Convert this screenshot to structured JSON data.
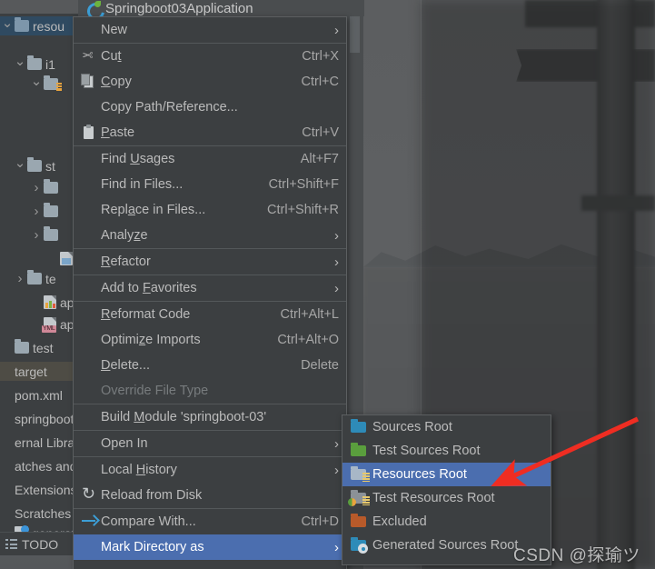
{
  "window": {
    "editor_tab": {
      "title": "Springboot03Application",
      "icon": "spring-boot-icon"
    }
  },
  "sidebar": {
    "tree": [
      {
        "label": "resou",
        "indent": 0,
        "chevron": "down",
        "icon": "folder-blue-icon",
        "selected": true
      },
      {
        "label": "i1",
        "indent": 1,
        "chevron": "down",
        "icon": "folder-icon",
        "selected": false
      },
      {
        "label": "",
        "indent": 2,
        "chevron": "down",
        "icon": "folder-resources-icon",
        "selected": false
      },
      {
        "label": "st",
        "indent": 1,
        "chevron": "down",
        "icon": "folder-icon",
        "selected": false
      },
      {
        "label": "",
        "indent": 2,
        "chevron": "right",
        "icon": "folder-icon",
        "selected": false
      },
      {
        "label": "",
        "indent": 2,
        "chevron": "right",
        "icon": "folder-icon",
        "selected": false
      },
      {
        "label": "",
        "indent": 2,
        "chevron": "right",
        "icon": "folder-icon",
        "selected": false
      },
      {
        "label": "",
        "indent": 3,
        "chevron": "none",
        "icon": "image-file-icon",
        "selected": false
      },
      {
        "label": "te",
        "indent": 1,
        "chevron": "right",
        "icon": "folder-icon",
        "selected": false
      },
      {
        "label": "ap",
        "indent": 2,
        "chevron": "none",
        "icon": "properties-file-icon",
        "selected": false
      },
      {
        "label": "ap",
        "indent": 2,
        "chevron": "none",
        "icon": "yml-file-icon",
        "selected": false
      },
      {
        "label": "test",
        "indent": 0,
        "chevron": "none",
        "icon": "folder-icon",
        "selected": false
      },
      {
        "label": "target",
        "indent": 0,
        "chevron": "none",
        "icon": "none",
        "selected": false,
        "highlight2": true
      },
      {
        "label": "pom.xml",
        "indent": 0,
        "chevron": "none",
        "icon": "none",
        "selected": false
      },
      {
        "label": "springboot",
        "indent": 0,
        "chevron": "none",
        "icon": "none",
        "selected": false
      },
      {
        "label": "ernal Librar",
        "indent": 0,
        "chevron": "none",
        "icon": "none",
        "selected": false
      },
      {
        "label": "atches and",
        "indent": 0,
        "chevron": "none",
        "icon": "none",
        "selected": false
      },
      {
        "label": "Extensions",
        "indent": 0,
        "chevron": "none",
        "icon": "none",
        "selected": false
      },
      {
        "label": "Scratches",
        "indent": 0,
        "chevron": "none",
        "icon": "none",
        "selected": false
      },
      {
        "label": "generat",
        "indent": 0,
        "chevron": "none",
        "icon": "api-file-icon",
        "selected": false
      }
    ],
    "todo": {
      "label": "TODO",
      "icon": "todo-list-icon"
    }
  },
  "context_menu": {
    "items": [
      {
        "label": "New",
        "accel": "",
        "icon": "",
        "submenu": true,
        "disabled": false,
        "highlighted": false,
        "sep_after": true
      },
      {
        "label": "Cut",
        "accel": "Ctrl+X",
        "icon": "cut-icon",
        "submenu": false,
        "disabled": false,
        "highlighted": false,
        "sep_after": false,
        "mnemonic": "t"
      },
      {
        "label": "Copy",
        "accel": "Ctrl+C",
        "icon": "copy-icon",
        "submenu": false,
        "disabled": false,
        "highlighted": false,
        "sep_after": false,
        "mnemonic": "C"
      },
      {
        "label": "Copy Path/Reference...",
        "accel": "",
        "icon": "",
        "submenu": false,
        "disabled": false,
        "highlighted": false,
        "sep_after": false
      },
      {
        "label": "Paste",
        "accel": "Ctrl+V",
        "icon": "paste-icon",
        "submenu": false,
        "disabled": false,
        "highlighted": false,
        "sep_after": true,
        "mnemonic": "P"
      },
      {
        "label": "Find Usages",
        "accel": "Alt+F7",
        "icon": "",
        "submenu": false,
        "disabled": false,
        "highlighted": false,
        "sep_after": false,
        "mnemonic": "U"
      },
      {
        "label": "Find in Files...",
        "accel": "Ctrl+Shift+F",
        "icon": "",
        "submenu": false,
        "disabled": false,
        "highlighted": false,
        "sep_after": false
      },
      {
        "label": "Replace in Files...",
        "accel": "Ctrl+Shift+R",
        "icon": "",
        "submenu": false,
        "disabled": false,
        "highlighted": false,
        "sep_after": false,
        "mnemonic": "a"
      },
      {
        "label": "Analyze",
        "accel": "",
        "icon": "",
        "submenu": true,
        "disabled": false,
        "highlighted": false,
        "sep_after": true,
        "mnemonic": "z"
      },
      {
        "label": "Refactor",
        "accel": "",
        "icon": "",
        "submenu": true,
        "disabled": false,
        "highlighted": false,
        "sep_after": true,
        "mnemonic": "R"
      },
      {
        "label": "Add to Favorites",
        "accel": "",
        "icon": "",
        "submenu": true,
        "disabled": false,
        "highlighted": false,
        "sep_after": true,
        "mnemonic": "F"
      },
      {
        "label": "Reformat Code",
        "accel": "Ctrl+Alt+L",
        "icon": "",
        "submenu": false,
        "disabled": false,
        "highlighted": false,
        "sep_after": false,
        "mnemonic": "R"
      },
      {
        "label": "Optimize Imports",
        "accel": "Ctrl+Alt+O",
        "icon": "",
        "submenu": false,
        "disabled": false,
        "highlighted": false,
        "sep_after": false,
        "mnemonic": "z"
      },
      {
        "label": "Delete...",
        "accel": "Delete",
        "icon": "",
        "submenu": false,
        "disabled": false,
        "highlighted": false,
        "sep_after": false,
        "mnemonic": "D"
      },
      {
        "label": "Override File Type",
        "accel": "",
        "icon": "",
        "submenu": false,
        "disabled": true,
        "highlighted": false,
        "sep_after": true
      },
      {
        "label": "Build Module 'springboot-03'",
        "accel": "",
        "icon": "",
        "submenu": false,
        "disabled": false,
        "highlighted": false,
        "sep_after": true,
        "mnemonic": "M"
      },
      {
        "label": "Open In",
        "accel": "",
        "icon": "",
        "submenu": true,
        "disabled": false,
        "highlighted": false,
        "sep_after": true
      },
      {
        "label": "Local History",
        "accel": "",
        "icon": "",
        "submenu": true,
        "disabled": false,
        "highlighted": false,
        "sep_after": false,
        "mnemonic": "H"
      },
      {
        "label": "Reload from Disk",
        "accel": "",
        "icon": "reload-icon",
        "submenu": false,
        "disabled": false,
        "highlighted": false,
        "sep_after": true
      },
      {
        "label": "Compare With...",
        "accel": "Ctrl+D",
        "icon": "compare-icon",
        "submenu": false,
        "disabled": false,
        "highlighted": false,
        "sep_after": false
      },
      {
        "label": "Mark Directory as",
        "accel": "",
        "icon": "",
        "submenu": true,
        "disabled": false,
        "highlighted": true,
        "sep_after": false
      }
    ]
  },
  "submenu": {
    "title": "Mark Directory as",
    "items": [
      {
        "label": "Sources Root",
        "icon": "sources-root-folder-icon",
        "highlighted": false
      },
      {
        "label": "Test Sources Root",
        "icon": "test-sources-root-folder-icon",
        "highlighted": false
      },
      {
        "label": "Resources Root",
        "icon": "resources-root-folder-icon",
        "highlighted": true
      },
      {
        "label": "Test Resources Root",
        "icon": "test-resources-root-folder-icon",
        "highlighted": false
      },
      {
        "label": "Excluded",
        "icon": "excluded-folder-icon",
        "highlighted": false
      },
      {
        "label": "Generated Sources Root",
        "icon": "generated-sources-root-folder-icon",
        "highlighted": false
      }
    ]
  },
  "annotation": {
    "arrow": {
      "name": "red-pointer-arrow",
      "color": "#ef2d22",
      "points_to": "Resources Root"
    }
  },
  "watermark": {
    "text": "CSDN @探瑜ツ"
  },
  "colors": {
    "menu_bg": "#3c3f41",
    "menu_border": "#5c5f61",
    "highlight": "#4b6eaf",
    "text": "#bbbbbb",
    "accel_text": "#a6a6a6",
    "disabled_text": "#777b7d",
    "tree_selection": "#2f4a61",
    "arrow_red": "#ef2d22"
  }
}
